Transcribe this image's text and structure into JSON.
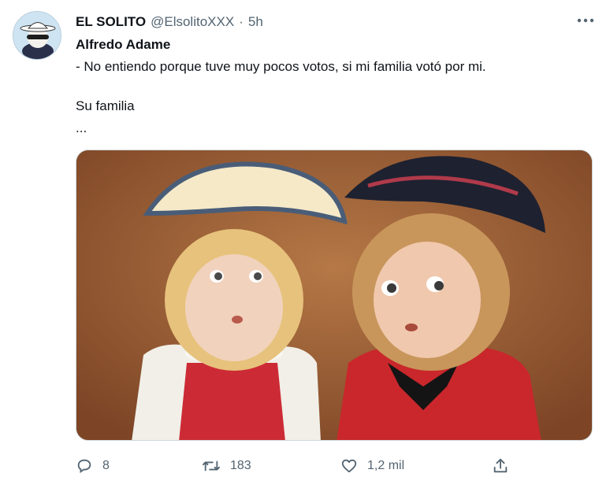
{
  "tweet": {
    "author_name": "EL SOLITO",
    "handle": "@ElsolitoXXX",
    "separator": "·",
    "time": "5h",
    "lines": [
      "Alfredo Adame",
      "- No entiendo porque tuve muy pocos votos, si mi familia votó por mi.",
      "Su familia",
      "..."
    ],
    "media_icon": "photo-two-dolls",
    "more_icon": "more-horizontal-icon"
  },
  "actions": {
    "reply_count": "8",
    "retweet_count": "183",
    "like_count": "1,2 mil",
    "icons": [
      "reply-icon",
      "retweet-icon",
      "like-icon",
      "share-icon"
    ]
  },
  "colors": {
    "text": "#0f1419",
    "secondary": "#536471",
    "border": "#cfd9de"
  }
}
